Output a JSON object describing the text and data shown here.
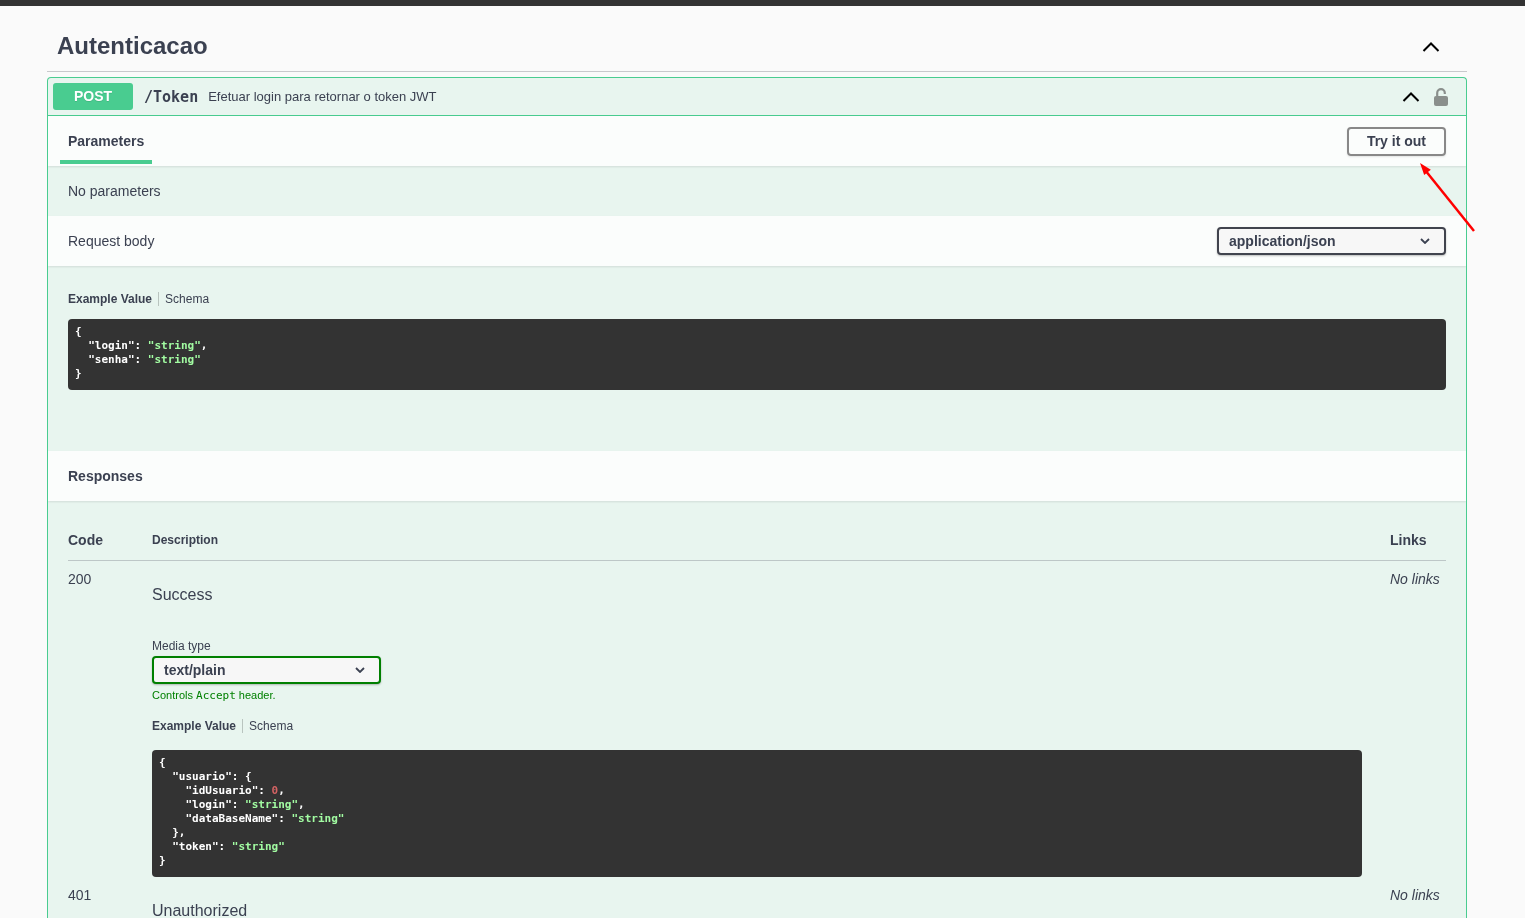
{
  "section": {
    "title": "Autenticacao",
    "expanded": true
  },
  "operation": {
    "method": "POST",
    "path": "/Token",
    "summary": "Efetuar login para retornar o token JWT",
    "expanded": true,
    "tabs": [
      {
        "label": "Parameters",
        "selected": true
      }
    ],
    "try_it_out": "Try it out",
    "parameters": {
      "empty_text": "No parameters"
    },
    "request_body": {
      "label": "Request body",
      "content_type": "application/json",
      "example_tabs": [
        {
          "label": "Example Value",
          "selected": true
        },
        {
          "label": "Schema",
          "selected": false
        }
      ],
      "example": "{\n  \"login\": \"string\",\n  \"senha\": \"string\"\n}"
    },
    "responses": {
      "title": "Responses",
      "columns": [
        "Code",
        "Description",
        "Links"
      ],
      "rows": [
        {
          "code": "200",
          "description": "Success",
          "links": "No links",
          "media_type": {
            "label": "Media type",
            "value": "text/plain",
            "hint": {
              "before": "Controls",
              "code": "Accept",
              "after": "header."
            }
          },
          "example_tabs": [
            {
              "label": "Example Value",
              "selected": true
            },
            {
              "label": "Schema",
              "selected": false
            }
          ],
          "example": "{\n  \"usuario\": {\n    \"idUsuario\": 0,\n    \"login\": \"string\",\n    \"dataBaseName\": \"string\"\n  },\n  \"token\": \"string\"\n}"
        },
        {
          "code": "401",
          "description": "Unauthorized",
          "links": "No links"
        }
      ]
    }
  },
  "annotations": [
    {
      "kind": "arrow"
    }
  ]
}
